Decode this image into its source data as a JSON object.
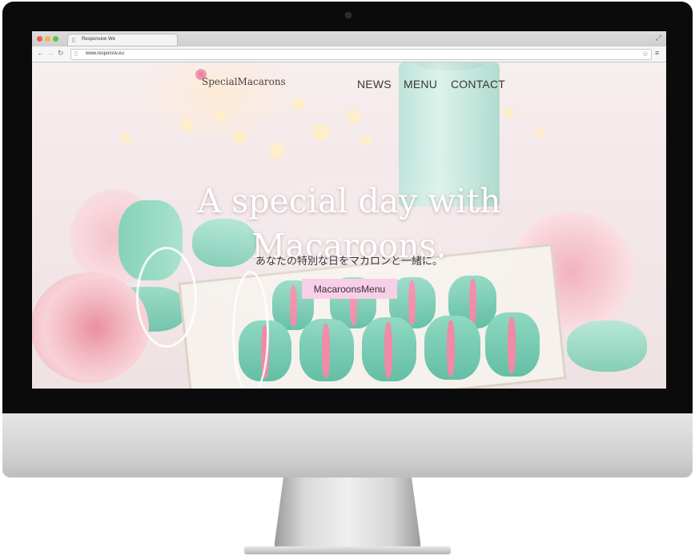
{
  "browser": {
    "tab_title": "Responsive We",
    "url": "www.responsiv.eu"
  },
  "site": {
    "logo_text": "SpecialMacarons",
    "nav": [
      "NEWS",
      "MENU",
      "CONTACT"
    ]
  },
  "hero": {
    "heading_line1": "A special day with",
    "heading_line2": "Macaroons.",
    "subheading": "あなたの特別な日をマカロンと一緒に。",
    "cta_label": "MacaroonsMenu"
  },
  "colors": {
    "cta_background": "#f7cfe6",
    "macaron_mint": "#7fd0b8",
    "macaron_pink": "#f08aa6",
    "rose_pink": "#f3b9c3"
  },
  "icons": [
    "close-icon",
    "minimize-icon",
    "maximize-icon",
    "page-icon",
    "fullscreen-icon",
    "back-icon",
    "forward-icon",
    "reload-icon",
    "star-icon",
    "menu-icon"
  ]
}
